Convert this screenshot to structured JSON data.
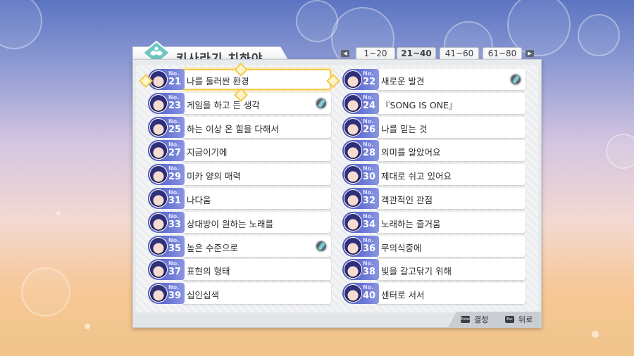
{
  "header": {
    "title": "키사라기 치하야"
  },
  "page_tabs": [
    {
      "label": "1~20",
      "active": false
    },
    {
      "label": "21~40",
      "active": true
    },
    {
      "label": "41~60",
      "active": false
    },
    {
      "label": "61~80",
      "active": false
    }
  ],
  "tab_nav_keys": {
    "left": "",
    "right": ""
  },
  "items": [
    {
      "no": "No.",
      "num": "21",
      "title": "나를 둘러싼 환경",
      "badge": false,
      "selected": true
    },
    {
      "no": "No.",
      "num": "22",
      "title": "새로운 발견",
      "badge": true,
      "selected": false
    },
    {
      "no": "No.",
      "num": "23",
      "title": "게임을 하고 든 생각",
      "badge": true,
      "selected": false
    },
    {
      "no": "No.",
      "num": "24",
      "title": "『SONG IS ONE』",
      "badge": false,
      "selected": false
    },
    {
      "no": "No.",
      "num": "25",
      "title": "하는 이상 온 힘을 다해서",
      "badge": false,
      "selected": false
    },
    {
      "no": "No.",
      "num": "26",
      "title": "나를 믿는 것",
      "badge": false,
      "selected": false
    },
    {
      "no": "No.",
      "num": "27",
      "title": "지금이기에",
      "badge": false,
      "selected": false
    },
    {
      "no": "No.",
      "num": "28",
      "title": "의미를 알았어요",
      "badge": false,
      "selected": false
    },
    {
      "no": "No.",
      "num": "29",
      "title": "미카 양의 매력",
      "badge": false,
      "selected": false
    },
    {
      "no": "No.",
      "num": "30",
      "title": "제대로 쉬고 있어요",
      "badge": false,
      "selected": false
    },
    {
      "no": "No.",
      "num": "31",
      "title": "나다움",
      "badge": false,
      "selected": false
    },
    {
      "no": "No.",
      "num": "32",
      "title": "객관적인 관점",
      "badge": false,
      "selected": false
    },
    {
      "no": "No.",
      "num": "33",
      "title": "상대방이 원하는 노래를",
      "badge": false,
      "selected": false
    },
    {
      "no": "No.",
      "num": "34",
      "title": "노래하는 즐거움",
      "badge": false,
      "selected": false
    },
    {
      "no": "No.",
      "num": "35",
      "title": "높은 수준으로",
      "badge": true,
      "selected": false
    },
    {
      "no": "No.",
      "num": "36",
      "title": "무의식중에",
      "badge": false,
      "selected": false
    },
    {
      "no": "No.",
      "num": "37",
      "title": "표현의 형태",
      "badge": false,
      "selected": false
    },
    {
      "no": "No.",
      "num": "38",
      "title": "빛을 갈고닦기 위해",
      "badge": false,
      "selected": false
    },
    {
      "no": "No.",
      "num": "39",
      "title": "십인십색",
      "badge": false,
      "selected": false
    },
    {
      "no": "No.",
      "num": "40",
      "title": "센터로 서서",
      "badge": false,
      "selected": false
    }
  ],
  "footer": {
    "confirm_key": "Enter",
    "confirm_label": "결정",
    "back_key": "Esc",
    "back_label": "뒤로"
  },
  "colors": {
    "accent": "#f2c94c",
    "number_badge": "#5a64c4"
  }
}
